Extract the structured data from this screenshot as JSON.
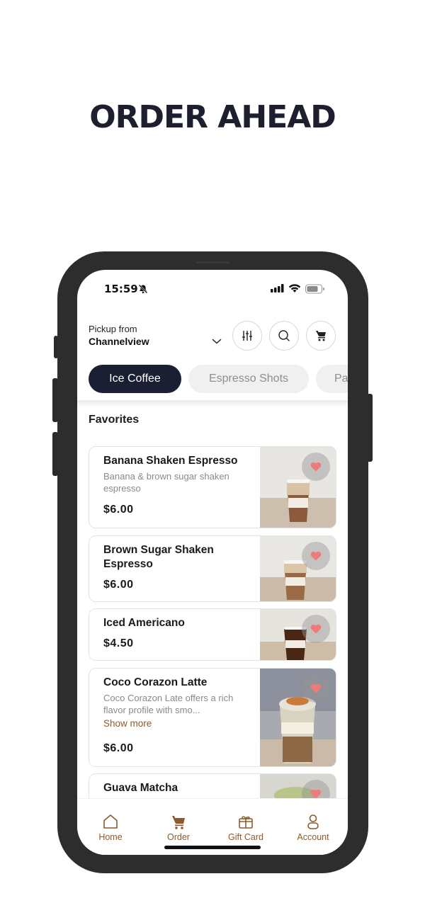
{
  "headline": "ORDER AHEAD",
  "status_bar": {
    "time": "15:59"
  },
  "pickup": {
    "label": "Pickup from",
    "location": "Channelview"
  },
  "tabs": [
    {
      "label": "Ice Coffee",
      "active": true
    },
    {
      "label": "Espresso Shots",
      "active": false
    },
    {
      "label": "Pa",
      "active": false
    }
  ],
  "section_title": "Favorites",
  "items": [
    {
      "name": "Banana Shaken Espresso",
      "description": "Banana & brown sugar shaken espresso",
      "price": "$6.00",
      "favorite": true
    },
    {
      "name": "Brown Sugar Shaken Espresso",
      "description": "",
      "price": "$6.00",
      "favorite": true
    },
    {
      "name": "Iced Americano",
      "description": "",
      "price": "$4.50",
      "favorite": true
    },
    {
      "name": "Coco Corazon Latte",
      "description": "Coco Corazon Late offers a rich flavor profile with smo...",
      "show_more": "Show more",
      "price": "$6.00",
      "favorite": true
    },
    {
      "name": "Guava Matcha",
      "description": "",
      "price": "",
      "favorite": true
    }
  ],
  "bottom_nav": [
    {
      "label": "Home",
      "icon": "home-icon"
    },
    {
      "label": "Order",
      "icon": "cart-icon"
    },
    {
      "label": "Gift Card",
      "icon": "gift-card-icon"
    },
    {
      "label": "Account",
      "icon": "account-icon"
    }
  ],
  "colors": {
    "accent": "#8b5a2b",
    "tab_active": "#1a1f33",
    "heart": "#f07a7a",
    "phone_frame": "#2d2d2d"
  }
}
